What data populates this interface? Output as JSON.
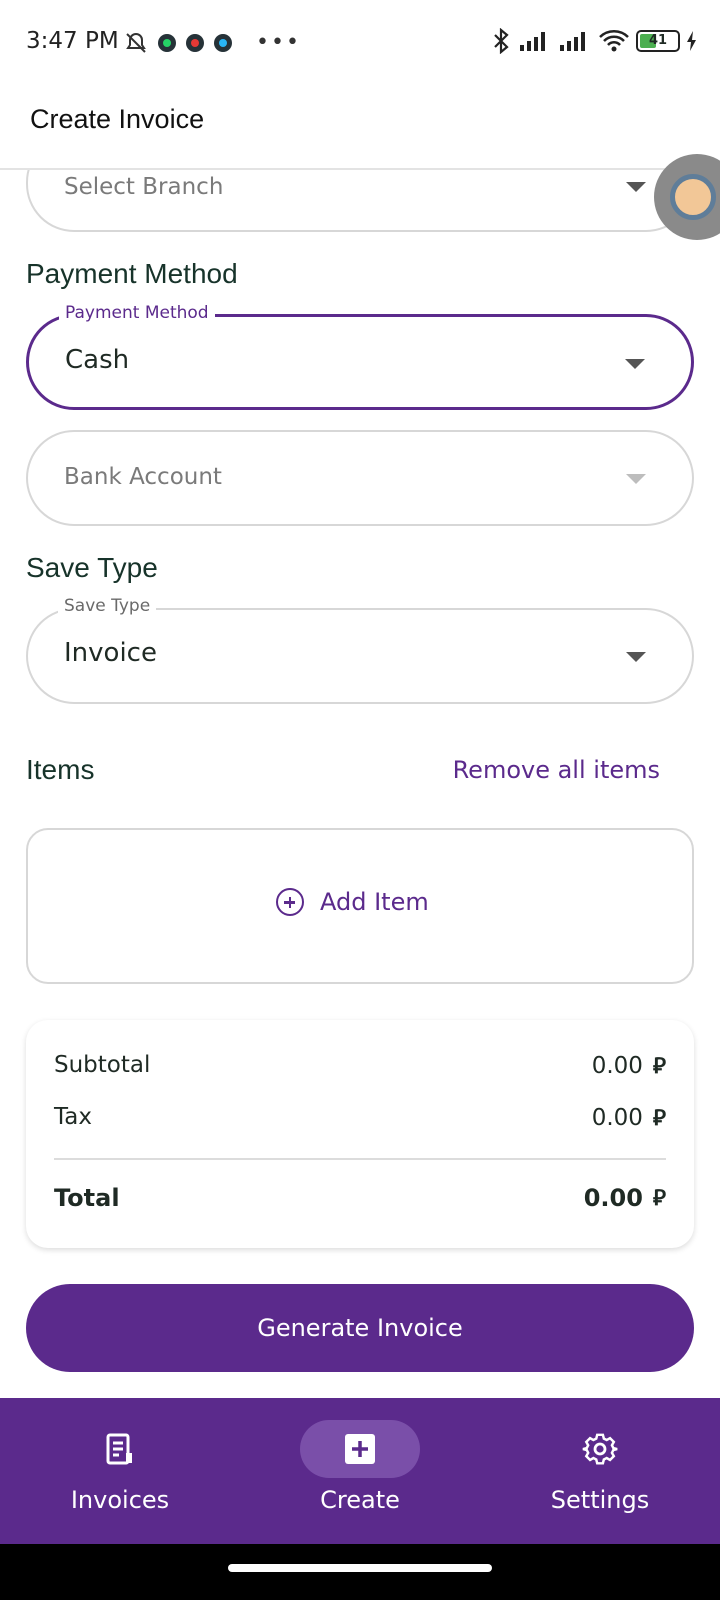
{
  "status_bar": {
    "time": "3:47 PM",
    "more": "•••",
    "battery": "41",
    "icons": [
      "bell-off-icon",
      "whatsapp-icon",
      "app-icon",
      "telegram-icon",
      "bluetooth-icon",
      "signal-icon",
      "signal-icon",
      "wifi-icon",
      "battery-icon",
      "charging-icon"
    ]
  },
  "app_bar": {
    "title": "Create Invoice"
  },
  "branch": {
    "placeholder": "Select Branch"
  },
  "payment": {
    "section_title": "Payment Method",
    "field_label": "Payment Method",
    "value": "Cash",
    "bank_placeholder": "Bank Account"
  },
  "save_type": {
    "section_title": "Save Type",
    "field_label": "Save Type",
    "value": "Invoice"
  },
  "items": {
    "section_title": "Items",
    "remove_all_label": "Remove all items",
    "add_item_label": "Add Item"
  },
  "summary": {
    "subtotal_label": "Subtotal",
    "subtotal_value": "0.00",
    "tax_label": "Tax",
    "tax_value": "0.00",
    "total_label": "Total",
    "total_value": "0.00",
    "currency_symbol": "⃁"
  },
  "generate_button": "Generate Invoice",
  "bottom_nav": [
    {
      "label": "Invoices",
      "icon": "receipt-icon",
      "active": false
    },
    {
      "label": "Create",
      "icon": "add-box-icon",
      "active": true
    },
    {
      "label": "Settings",
      "icon": "gear-icon",
      "active": false
    }
  ],
  "colors": {
    "primary": "#5b2a8c",
    "primary_light": "#7a4fa9",
    "text_dark": "#17332a",
    "border": "#d7d7d7"
  }
}
